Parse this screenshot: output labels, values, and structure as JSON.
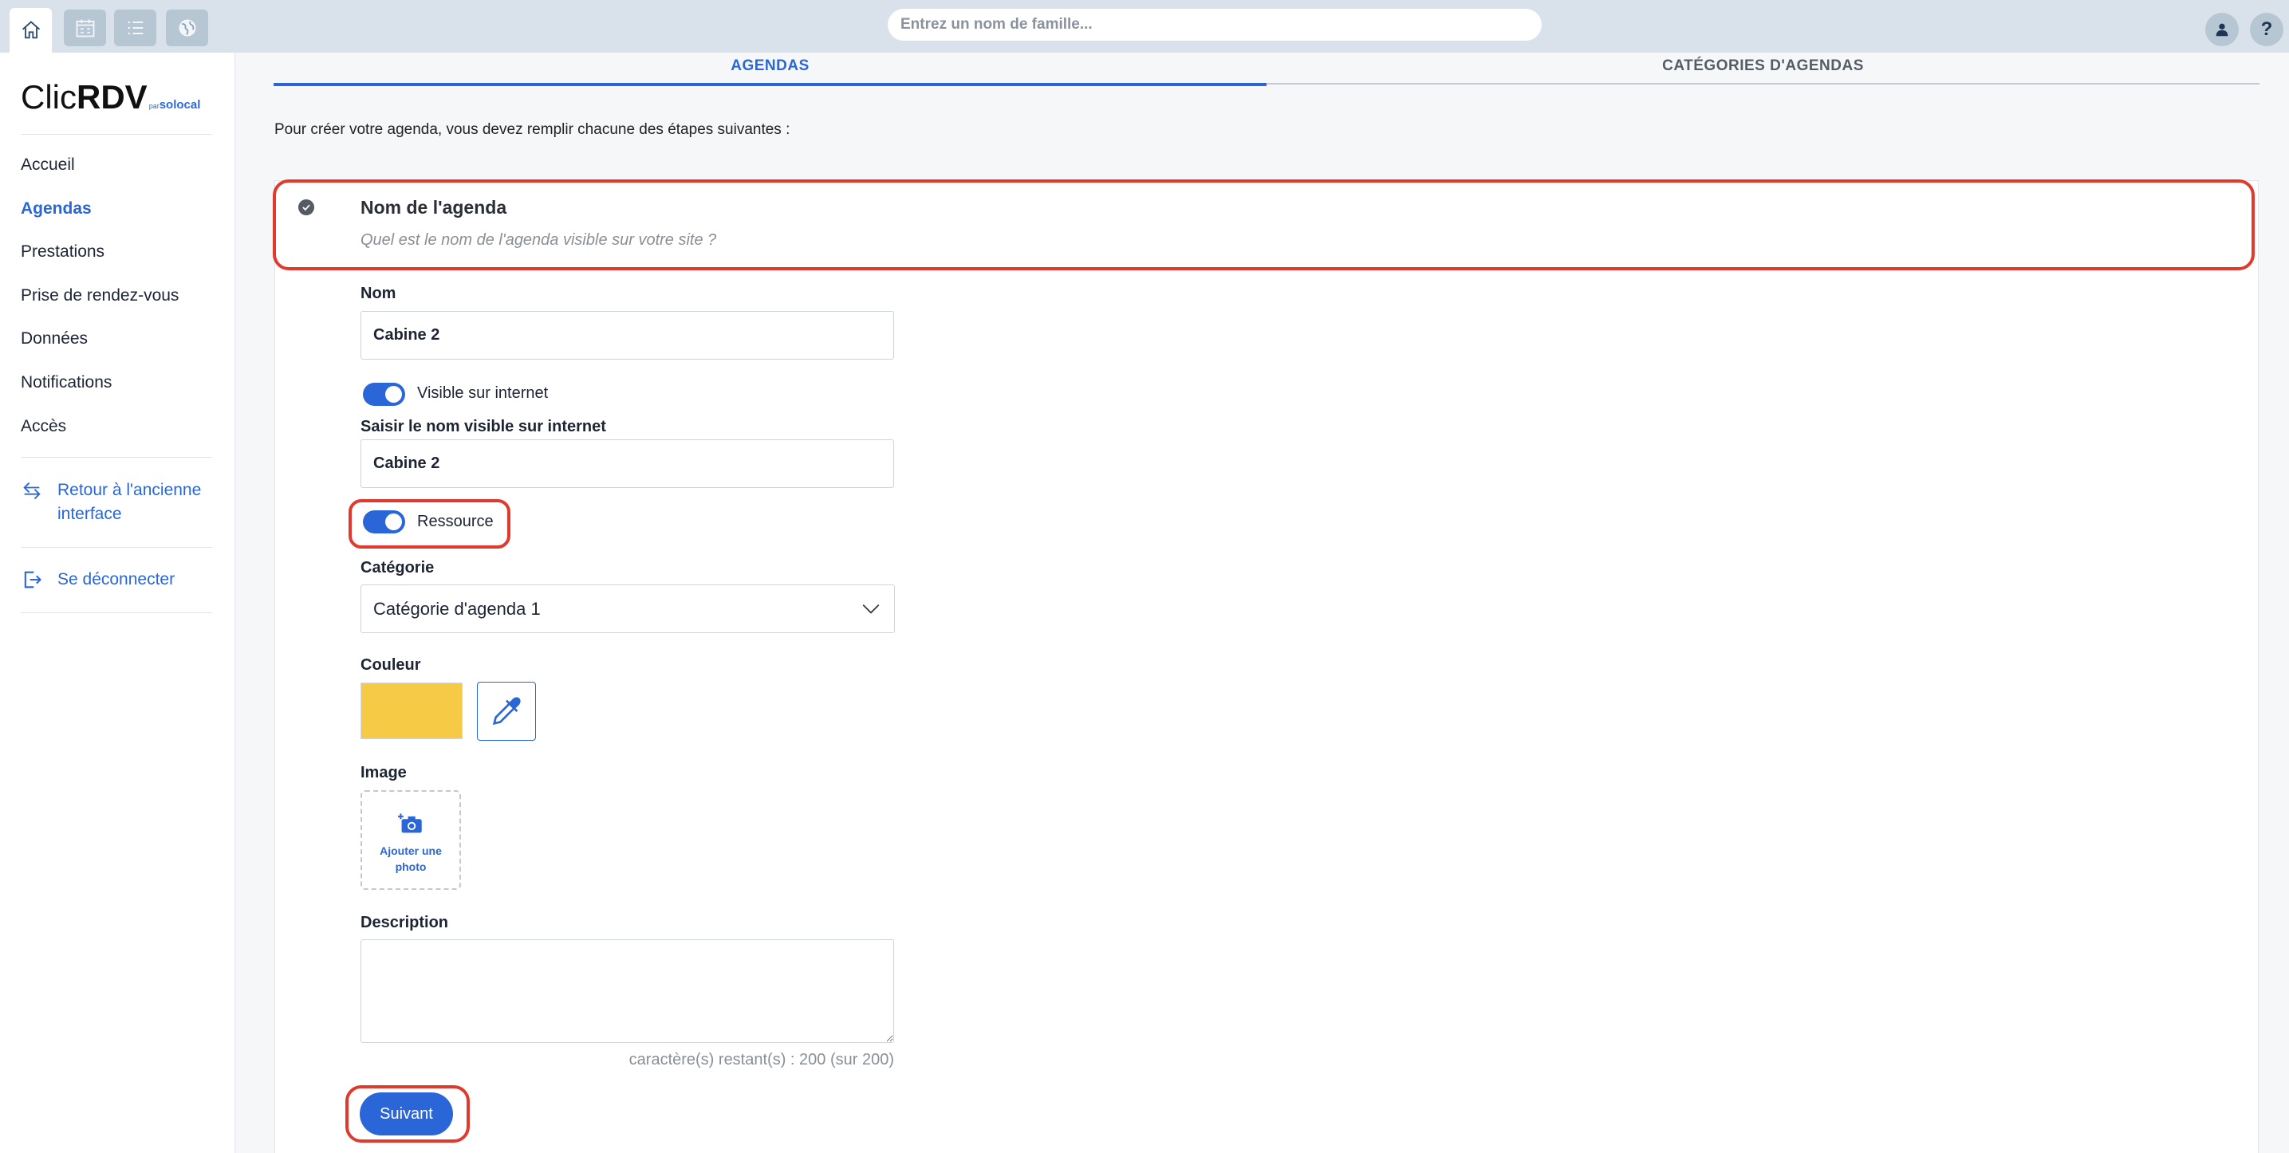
{
  "topbar": {
    "search_placeholder": "Entrez un nom de famille...",
    "icons": [
      "home-icon",
      "calendar-icon",
      "list-icon",
      "globe-icon"
    ],
    "help_label": "?"
  },
  "sidebar": {
    "logo_main": "Clic",
    "logo_bold": "RDV",
    "logo_par": "par",
    "logo_brand": "solocal",
    "items": [
      {
        "label": "Accueil",
        "active": false
      },
      {
        "label": "Agendas",
        "active": true
      },
      {
        "label": "Prestations",
        "active": false
      },
      {
        "label": "Prise de rendez-vous",
        "active": false
      },
      {
        "label": "Données",
        "active": false
      },
      {
        "label": "Notifications",
        "active": false
      },
      {
        "label": "Accès",
        "active": false
      }
    ],
    "back_link": "Retour à l'ancienne interface",
    "logout_link": "Se déconnecter"
  },
  "tabs": [
    {
      "label": "AGENDAS",
      "active": true
    },
    {
      "label": "CATÉGORIES D'AGENDAS",
      "active": false
    }
  ],
  "intro_text": "Pour créer votre agenda, vous devez remplir chacune des étapes suivantes :",
  "step": {
    "title": "Nom de l'agenda",
    "subtitle": "Quel est le nom de l'agenda visible sur votre site ?"
  },
  "form": {
    "nom_label": "Nom",
    "nom_value": "Cabine 2",
    "visible_toggle_label": "Visible sur internet",
    "visible_toggle_on": true,
    "visible_name_label": "Saisir le nom visible sur internet",
    "visible_name_value": "Cabine 2",
    "ressource_toggle_label": "Ressource",
    "ressource_toggle_on": true,
    "categorie_label": "Catégorie",
    "categorie_value": "Catégorie d'agenda 1",
    "couleur_label": "Couleur",
    "couleur_value": "#f7ca45",
    "image_label": "Image",
    "add_photo_label": "Ajouter une photo",
    "description_label": "Description",
    "description_value": "",
    "counter_text": "caractère(s) restant(s) : 200 (sur 200)",
    "next_button": "Suivant"
  },
  "colors": {
    "accent": "#2a66d8",
    "highlight": "#e03a2f"
  }
}
